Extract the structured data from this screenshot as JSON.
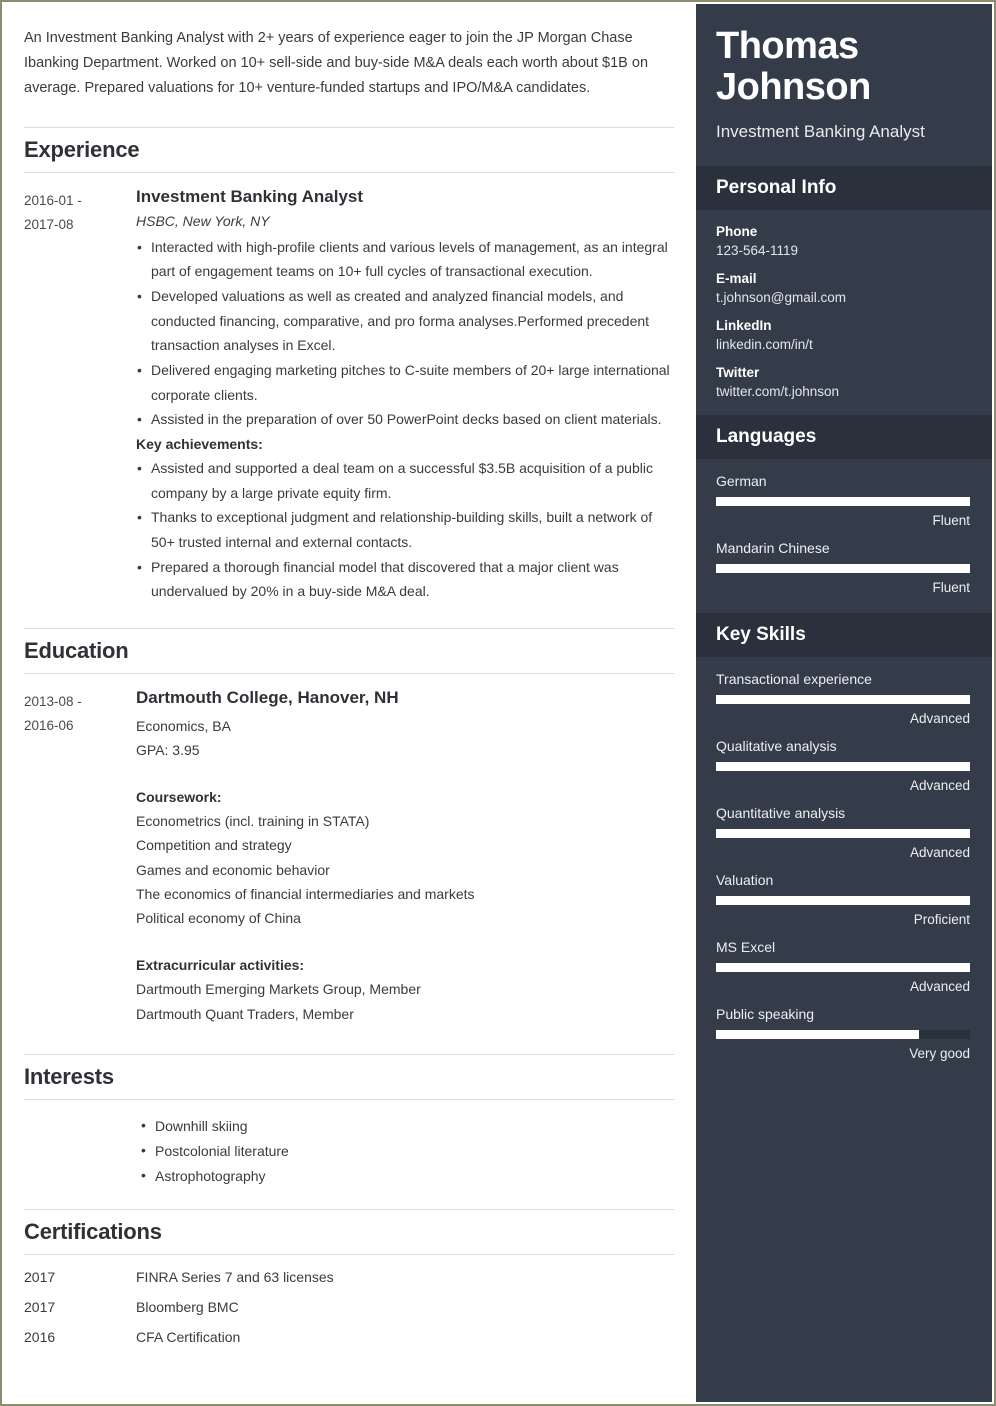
{
  "summary": "An Investment Banking Analyst with 2+ years of experience eager to join the JP Morgan Chase Ibanking Department. Worked on 10+ sell-side and buy-side M&A deals each worth about $1B on average. Prepared valuations for 10+ venture-funded startups and IPO/M&A candidates.",
  "sections": {
    "experience": {
      "heading": "Experience",
      "entry": {
        "dates_from": "2016-01 -",
        "dates_to": "2017-08",
        "title": "Investment Banking Analyst",
        "subtitle": "HSBC, New York, NY",
        "bullets": [
          "Interacted with high-profile clients and various levels of management, as an integral part of engagement teams on 10+ full cycles of transactional execution.",
          "Developed valuations as well as created and analyzed financial models, and conducted financing, comparative, and pro forma analyses.Performed precedent transaction analyses in Excel.",
          "Delivered engaging marketing pitches to C-suite members of 20+ large international corporate clients.",
          "Assisted in the preparation of over 50 PowerPoint decks based on client materials."
        ],
        "achievements_label": "Key achievements:",
        "achievements": [
          "Assisted and supported a deal team on a successful $3.5B acquisition of a public company by a large private equity firm.",
          "Thanks to exceptional judgment and relationship-building skills, built a network of 50+ trusted internal and external contacts.",
          "Prepared a thorough financial model that discovered that a major client was undervalued by 20% in a buy-side M&A deal."
        ]
      }
    },
    "education": {
      "heading": "Education",
      "entry": {
        "dates_from": "2013-08 -",
        "dates_to": "2016-06",
        "title": "Dartmouth College, Hanover, NH",
        "degree": "Economics, BA",
        "gpa": "GPA: 3.95",
        "coursework_label": "Coursework:",
        "coursework": [
          "Econometrics (incl. training in STATA)",
          "Competition and strategy",
          "Games and economic behavior",
          "The economics of financial intermediaries and markets",
          "Political economy of China"
        ],
        "extracurricular_label": "Extracurricular activities:",
        "extracurricular": [
          "Dartmouth Emerging Markets Group, Member",
          "Dartmouth Quant Traders, Member"
        ]
      }
    },
    "interests": {
      "heading": "Interests",
      "items": [
        "Downhill skiing",
        "Postcolonial literature",
        "Astrophotography"
      ]
    },
    "certifications": {
      "heading": "Certifications",
      "rows": [
        {
          "year": "2017",
          "name": "FINRA Series 7 and 63 licenses"
        },
        {
          "year": "2017",
          "name": "Bloomberg BMC"
        },
        {
          "year": "2016",
          "name": "CFA Certification"
        }
      ]
    }
  },
  "sidebar": {
    "full_name": "Thomas Johnson",
    "job_title": "Investment Banking Analyst",
    "personal_info": {
      "heading": "Personal Info",
      "items": [
        {
          "key": "Phone",
          "value": "123-564-1119"
        },
        {
          "key": "E-mail",
          "value": "t.johnson@gmail.com"
        },
        {
          "key": "LinkedIn",
          "value": "linkedin.com/in/t"
        },
        {
          "key": "Twitter",
          "value": "twitter.com/t.johnson"
        }
      ]
    },
    "languages": {
      "heading": "Languages",
      "items": [
        {
          "name": "German",
          "level": "Fluent",
          "percent": 100
        },
        {
          "name": "Mandarin Chinese",
          "level": "Fluent",
          "percent": 100
        }
      ]
    },
    "key_skills": {
      "heading": "Key Skills",
      "items": [
        {
          "name": "Transactional experience",
          "level": "Advanced",
          "percent": 100
        },
        {
          "name": "Qualitative analysis",
          "level": "Advanced",
          "percent": 100
        },
        {
          "name": "Quantitative analysis",
          "level": "Advanced",
          "percent": 100
        },
        {
          "name": "Valuation",
          "level": "Proficient",
          "percent": 100
        },
        {
          "name": "MS Excel",
          "level": "Advanced",
          "percent": 100
        },
        {
          "name": "Public speaking",
          "level": "Very good",
          "percent": 80
        }
      ]
    }
  },
  "colors": {
    "sidebar_bg": "#343c49",
    "sidebar_header_bg": "#2b313c",
    "page_border": "#8c8c6e",
    "bar_fill": "#ffffff",
    "text_dark": "#3b3b3b"
  }
}
